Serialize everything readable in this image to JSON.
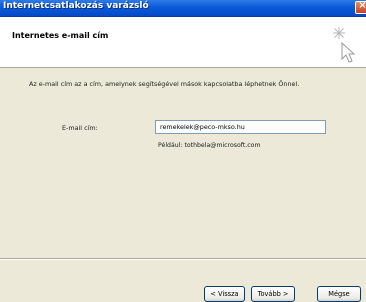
{
  "window": {
    "title": "Internetcsatlakozás varázsló"
  },
  "header": {
    "title": "Internetes e-mail cím",
    "icon": "wizard-wand-icon"
  },
  "main": {
    "description": "Az e-mail cím az a cím, amelynek segítségével mások kapcsolatba léphetnek Önnel.",
    "email_label": "E-mail cím:",
    "email_value": "remekelek@peco-mkso.hu",
    "example": "Például: tothbela@microsoft.com"
  },
  "buttons": {
    "back": "< Vissza",
    "next": "Tovább >",
    "finish": "Mégse"
  },
  "colors": {
    "titlebar": "#0a5bd9",
    "close": "#c5421e",
    "dialog_bg": "#ece9d8"
  }
}
